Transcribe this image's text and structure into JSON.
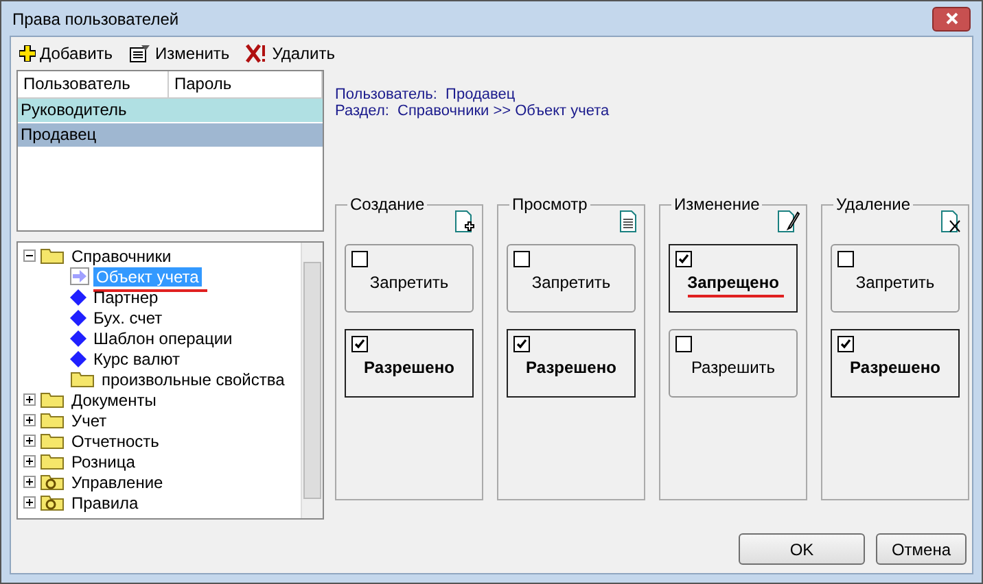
{
  "window": {
    "title": "Права пользователей"
  },
  "toolbar": [
    {
      "label": "Добавить",
      "kind": "add"
    },
    {
      "label": "Изменить",
      "kind": "edit"
    },
    {
      "label": "Удалить",
      "kind": "delete"
    }
  ],
  "users_table": {
    "columns": [
      "Пользователь",
      "Пароль"
    ],
    "rows": [
      {
        "name": "Руководитель",
        "highlighted": true,
        "selected": false
      },
      {
        "name": "Продавец",
        "highlighted": false,
        "selected": true
      }
    ]
  },
  "tree": [
    {
      "label": "Справочники",
      "kind": "folder",
      "expanded": true,
      "selected": false,
      "children": [
        {
          "label": "Объект учета",
          "kind": "arrow",
          "selected": true,
          "underlined": true
        },
        {
          "label": "Партнер",
          "kind": "diamond",
          "selected": false
        },
        {
          "label": "Бух. счет",
          "kind": "diamond",
          "selected": false
        },
        {
          "label": "Шаблон операции",
          "kind": "diamond",
          "selected": false
        },
        {
          "label": "Курс валют",
          "kind": "diamond",
          "selected": false
        },
        {
          "label": "произвольные свойства",
          "kind": "folder",
          "selected": false
        }
      ]
    },
    {
      "label": "Документы",
      "kind": "folder",
      "expanded": false,
      "selected": false
    },
    {
      "label": "Учет",
      "kind": "folder",
      "expanded": false,
      "selected": false
    },
    {
      "label": "Отчетность",
      "kind": "folder",
      "expanded": false,
      "selected": false
    },
    {
      "label": "Розница",
      "kind": "folder",
      "expanded": false,
      "selected": false
    },
    {
      "label": "Управление",
      "kind": "gear",
      "expanded": false,
      "selected": false
    },
    {
      "label": "Правила",
      "kind": "gear",
      "expanded": false,
      "selected": false
    }
  ],
  "info": [
    {
      "label": "Пользователь:",
      "value": "Продавец"
    },
    {
      "label": "Раздел:",
      "value": "Справочники >> Объект учета"
    }
  ],
  "permissions": [
    {
      "title": "Создание",
      "kind": "create",
      "options": [
        {
          "label": "Запретить",
          "checked": false,
          "underlined": false
        },
        {
          "label": "Разрешено",
          "checked": true,
          "underlined": false
        }
      ]
    },
    {
      "title": "Просмотр",
      "kind": "view",
      "options": [
        {
          "label": "Запретить",
          "checked": false,
          "underlined": false
        },
        {
          "label": "Разрешено",
          "checked": true,
          "underlined": false
        }
      ]
    },
    {
      "title": "Изменение",
      "kind": "edit",
      "options": [
        {
          "label": "Запрещено",
          "checked": true,
          "underlined": true
        },
        {
          "label": "Разрешить",
          "checked": false,
          "underlined": false
        }
      ]
    },
    {
      "title": "Удаление",
      "kind": "delete",
      "options": [
        {
          "label": "Запретить",
          "checked": false,
          "underlined": false
        },
        {
          "label": "Разрешено",
          "checked": true,
          "underlined": false
        }
      ]
    }
  ],
  "buttons": [
    "OK",
    "Отмена"
  ]
}
